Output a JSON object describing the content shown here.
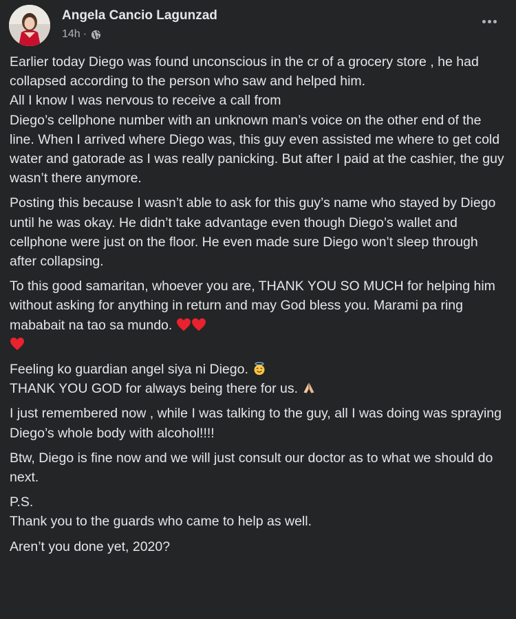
{
  "post": {
    "author": "Angela Cancio Lagunzad",
    "time": "14h",
    "time_separator": "·",
    "privacy_icon": "globe-icon",
    "more_icon": "more-options-icon",
    "paragraphs": {
      "p1": "Earlier today Diego was found unconscious in the cr of a grocery store , he had collapsed according to the person who saw and helped him.\nAll I know I was nervous to receive a call from\nDiego’s cellphone number with an unknown man’s voice on the other end of the line. When I arrived where Diego was, this guy even assisted me where to get cold water and gatorade as I was really panicking. But after I paid at the cashier, the guy wasn’t there anymore.",
      "p2": "Posting this because I wasn’t able to ask for this guy’s name who stayed by Diego until he was okay. He didn’t  take advantage even though Diego’s wallet and cellphone were just on the floor. He even made sure Diego won’t sleep through after collapsing.",
      "p3": "To this good samaritan, whoever you are, THANK YOU SO MUCH for helping him without asking for anything in return and may God bless you. Marami pa ring mababait na tao sa mundo.",
      "p4_line1": "Feeling ko guardian angel siya ni Diego.",
      "p4_line2": "THANK YOU GOD for always being there for us.",
      "p5": "I just remembered now , while I was talking to the guy, all I was doing was spraying Diego’s whole body with alcohol!!!!",
      "p6": "Btw, Diego is fine now and we will just consult our doctor as to what we should do next.",
      "p7_line1": "P.S.",
      "p7_line2": "Thank you to the guards who came to help as well.",
      "p8": "Aren’t you done yet, 2020?"
    },
    "emojis": {
      "hearts": [
        "red-heart-icon",
        "red-heart-icon",
        "red-heart-icon"
      ],
      "angel_face": "smiling-face-with-halo-icon",
      "pray": "folded-hands-icon"
    }
  }
}
